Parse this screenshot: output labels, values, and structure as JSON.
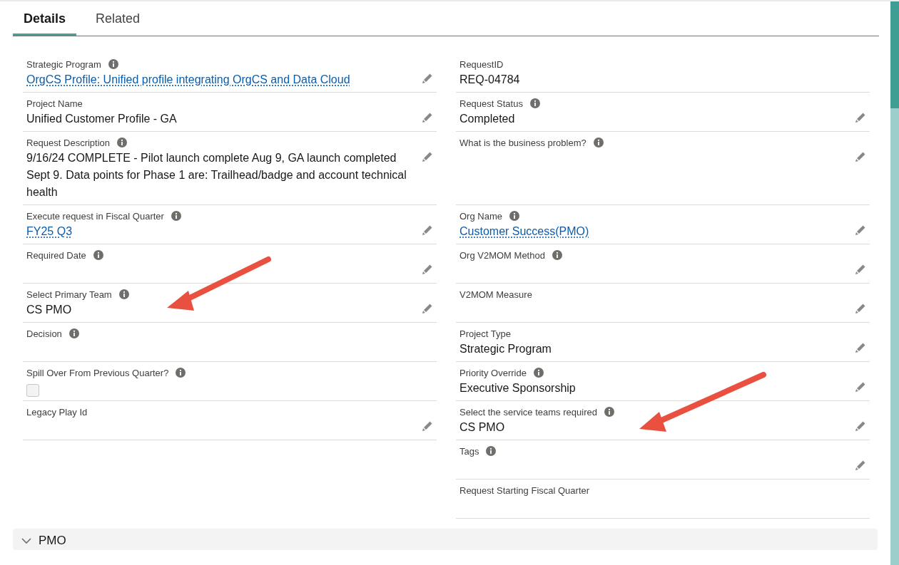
{
  "tabs": [
    {
      "label": "Details",
      "selected": true
    },
    {
      "label": "Related",
      "selected": false
    }
  ],
  "rows": [
    {
      "left": {
        "label": "Strategic Program",
        "info": true,
        "kind": "link",
        "value": "OrgCS Profile: Unified profile integrating OrgCS and Data Cloud",
        "editable": true
      },
      "right": {
        "label": "RequestID",
        "info": false,
        "kind": "text",
        "value": "REQ-04784",
        "editable": false
      }
    },
    {
      "left": {
        "label": "Project Name",
        "info": false,
        "kind": "text",
        "value": "Unified Customer Profile - GA",
        "editable": true
      },
      "right": {
        "label": "Request Status",
        "info": true,
        "kind": "text",
        "value": "Completed",
        "editable": true
      }
    },
    {
      "left": {
        "label": "Request Description",
        "info": true,
        "kind": "text",
        "value": "9/16/24 COMPLETE - Pilot launch complete Aug 9, GA launch completed Sept 9. Data points for Phase 1 are: Trailhead/badge and account technical health",
        "editable": true
      },
      "right": {
        "label": "What is the business problem?",
        "info": true,
        "kind": "text",
        "editable": true
      }
    },
    {
      "left": {
        "label": "Execute request in Fiscal Quarter",
        "info": true,
        "kind": "link",
        "value": "FY25 Q3",
        "editable": true
      },
      "right": {
        "label": "Org Name",
        "info": true,
        "kind": "link",
        "value": "Customer Success(PMO)",
        "editable": true
      }
    },
    {
      "left": {
        "label": "Required Date",
        "info": true,
        "kind": "text",
        "editable": true
      },
      "right": {
        "label": "Org V2MOM Method",
        "info": true,
        "kind": "text",
        "editable": true
      }
    },
    {
      "left": {
        "label": "Select Primary Team",
        "info": true,
        "kind": "text",
        "value": "CS PMO",
        "editable": true
      },
      "right": {
        "label": "V2MOM Measure",
        "info": false,
        "kind": "text",
        "editable": true
      }
    },
    {
      "left": {
        "label": "Decision",
        "info": true,
        "kind": "text",
        "editable": false
      },
      "right": {
        "label": "Project Type",
        "info": false,
        "kind": "text",
        "value": "Strategic Program",
        "editable": true
      }
    },
    {
      "left": {
        "label": "Spill Over From Previous Quarter?",
        "info": true,
        "kind": "checkbox",
        "checked": false,
        "editable": false
      },
      "right": {
        "label": "Priority Override",
        "info": true,
        "kind": "text",
        "value": "Executive Sponsorship",
        "editable": true
      }
    },
    {
      "left": {
        "label": "Legacy Play Id",
        "info": false,
        "kind": "text",
        "editable": true
      },
      "right": {
        "label": "Select the service teams required",
        "info": true,
        "kind": "text",
        "value": "CS PMO",
        "editable": true
      }
    },
    {
      "right": {
        "label": "Tags",
        "info": true,
        "kind": "text",
        "editable": true
      }
    },
    {
      "right": {
        "label": "Request Starting Fiscal Quarter",
        "info": false,
        "kind": "text",
        "editable": false
      }
    }
  ],
  "annotations": [
    {
      "kind": "arrow"
    },
    {
      "kind": "arrow"
    }
  ],
  "section": {
    "title": "PMO",
    "expanded": true
  }
}
